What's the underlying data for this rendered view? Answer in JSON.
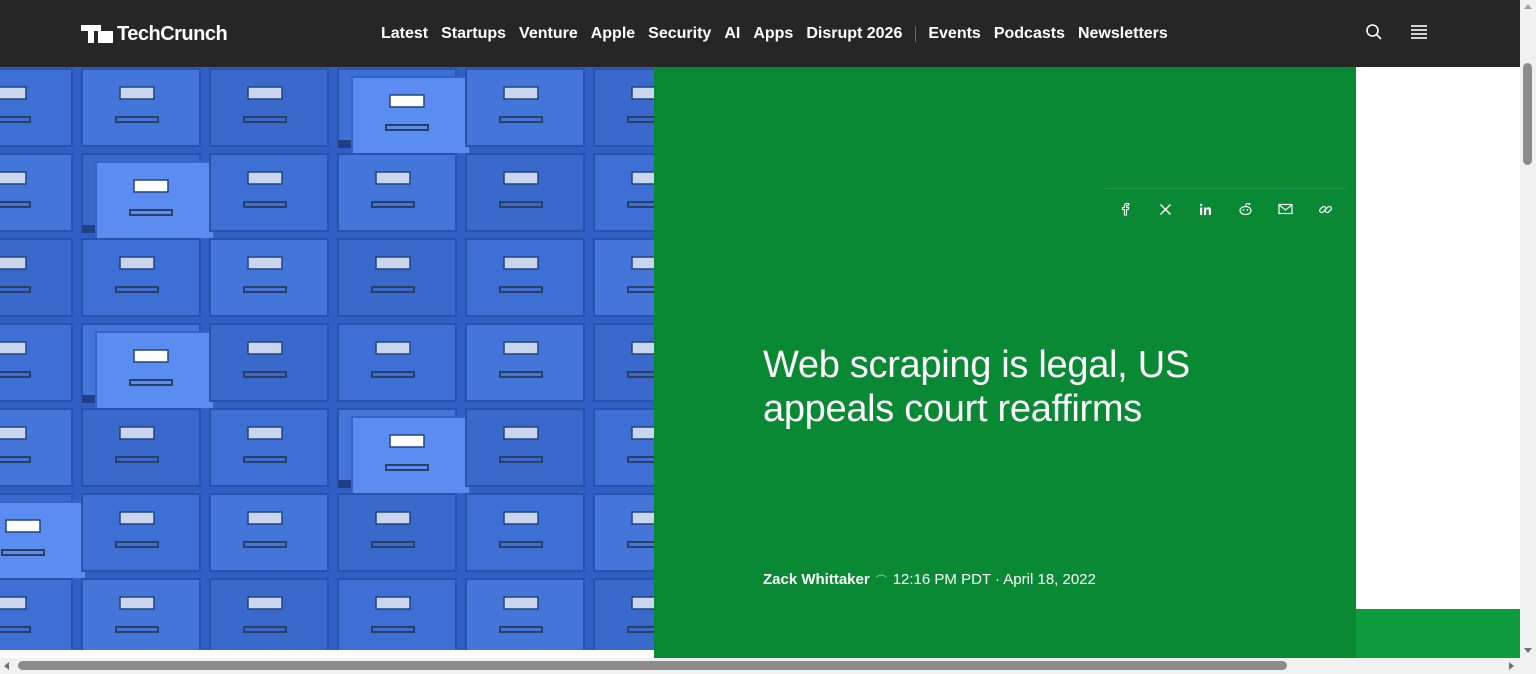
{
  "site": {
    "name": "TechCrunch"
  },
  "nav": {
    "primary": [
      "Latest",
      "Startups",
      "Venture",
      "Apple",
      "Security",
      "AI",
      "Apps",
      "Disrupt 2026"
    ],
    "secondary": [
      "Events",
      "Podcasts",
      "Newsletters"
    ]
  },
  "header_icons": [
    "search-icon",
    "menu-icon"
  ],
  "share_icons": [
    "facebook-icon",
    "x-icon",
    "linkedin-icon",
    "reddit-icon",
    "email-icon",
    "link-icon"
  ],
  "article": {
    "title": "Web scraping is legal, US appeals court reaffirms",
    "author": "Zack Whittaker",
    "datetime": "12:16 PM PDT · April 18, 2022"
  },
  "colors": {
    "topbar": "#262626",
    "hero_green": "#0a8935",
    "accent_green": "#0d9b3e",
    "cabinet_blue": "#4a7fe0"
  }
}
